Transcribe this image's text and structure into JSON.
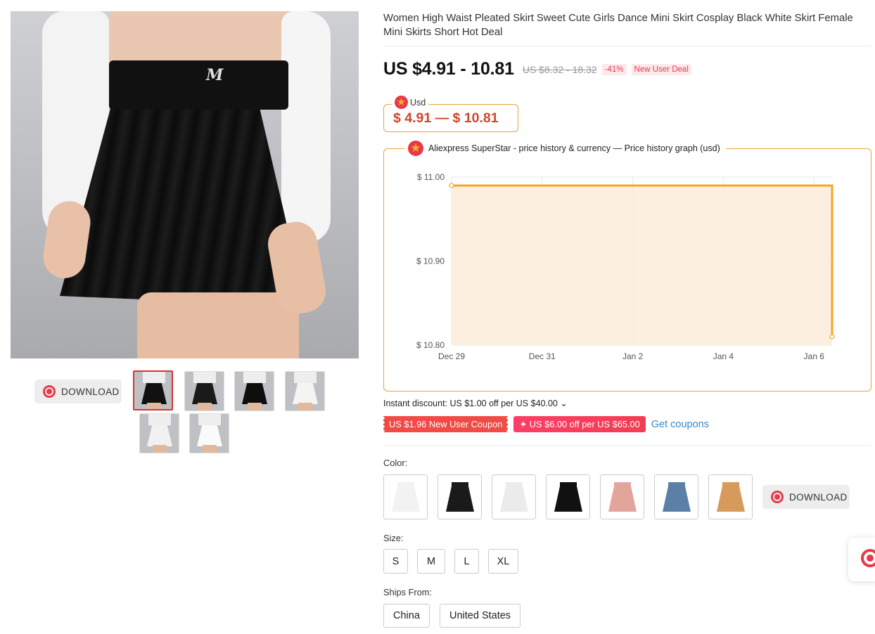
{
  "product": {
    "title": "Women High Waist Pleated Skirt Sweet Cute Girls Dance Mini Skirt Cosplay Black White Skirt Female Mini Skirts Short Hot Deal",
    "price": "US $4.91 - 10.81",
    "original_price": "US $8.32 - 18.32",
    "discount_badge": "-41%",
    "deal_badge": "New User Deal"
  },
  "gallery": {
    "download_label": "DOWNLOAD",
    "logo_letter": "M",
    "thumbnails": [
      {
        "skirt_color": "#111111"
      },
      {
        "skirt_color": "#1a1a1a"
      },
      {
        "skirt_color": "#0e0e0e"
      },
      {
        "skirt_color": "#f4f4f4"
      },
      {
        "skirt_color": "#f1f1f1"
      },
      {
        "skirt_color": "#fafafa"
      }
    ]
  },
  "currency_widget": {
    "legend": "Usd",
    "range": "$ 4.91 — $ 10.81"
  },
  "price_history": {
    "legend": "Aliexpress SuperStar - price history & currency — Price history graph (usd)"
  },
  "chart_data": {
    "type": "area",
    "title": "",
    "xlabel": "",
    "ylabel": "",
    "x_ticks": [
      "Dec 29",
      "Dec 31",
      "Jan 2",
      "Jan 4",
      "Jan 6"
    ],
    "y_ticks": [
      "$ 11.00",
      "$ 10.90",
      "$ 10.80"
    ],
    "ylim": [
      10.8,
      11.0
    ],
    "xlim": [
      "Dec 29",
      "Jan 6.2"
    ],
    "series": [
      {
        "x": [
          "Dec 29",
          "Jan 6.2",
          "Jan 6.2"
        ],
        "values": [
          10.99,
          10.99,
          10.81
        ]
      }
    ],
    "colors": {
      "line": "#f5a623",
      "fill": "#fdecd9",
      "grid": "#e6e6e6"
    },
    "grid": true
  },
  "promotions": {
    "instant_discount": "Instant discount: US $1.00 off per US $40.00 ⌄",
    "coupon_1": "US $1.96 New User Coupon",
    "coupon_2": "✦ US $6.00 off per US $65.00",
    "get_coupons": "Get coupons"
  },
  "options": {
    "color_label": "Color:",
    "colors": [
      {
        "name": "white",
        "hex": "#f2f2f2"
      },
      {
        "name": "black",
        "hex": "#1a1a1a"
      },
      {
        "name": "white-2",
        "hex": "#ebebeb"
      },
      {
        "name": "black-2",
        "hex": "#111111"
      },
      {
        "name": "pink",
        "hex": "#e3a59b"
      },
      {
        "name": "blue",
        "hex": "#5b7fa6"
      },
      {
        "name": "camel",
        "hex": "#d69a5c"
      }
    ],
    "download_label": "DOWNLOAD",
    "size_label": "Size:",
    "sizes": [
      "S",
      "M",
      "L",
      "XL"
    ],
    "ships_label": "Ships From:",
    "ships_from": [
      "China",
      "United States"
    ]
  }
}
